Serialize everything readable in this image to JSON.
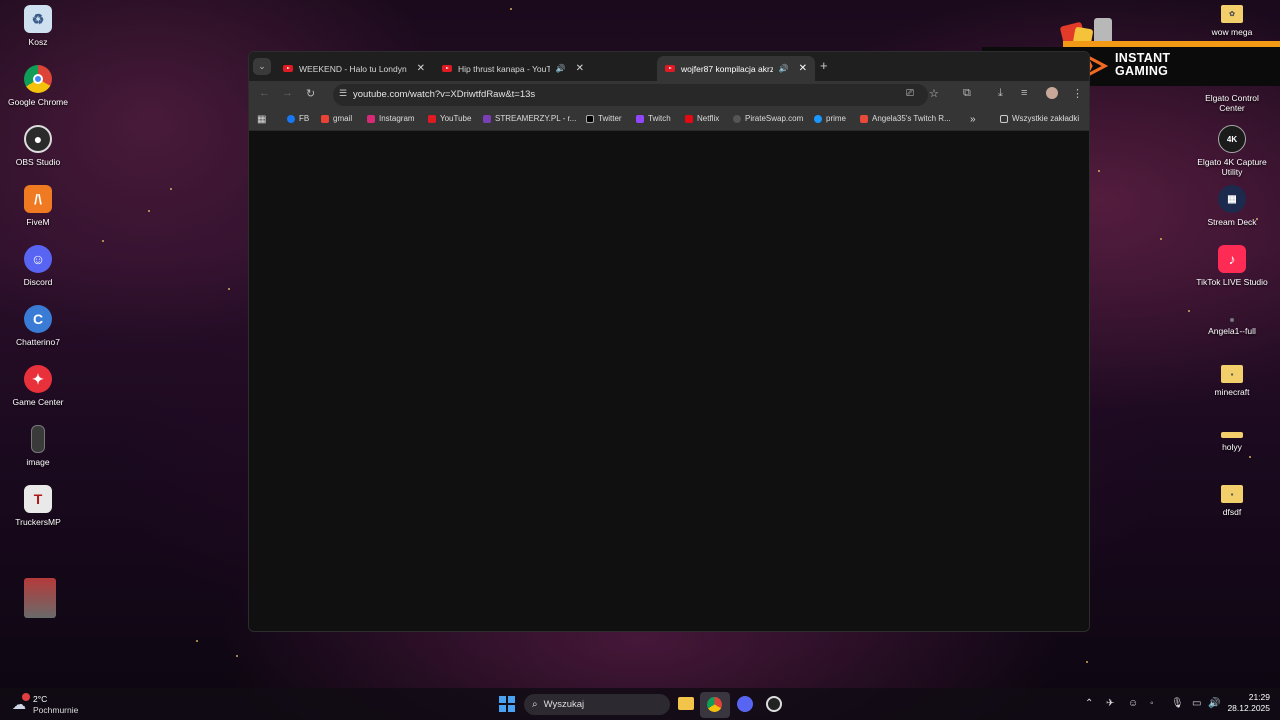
{
  "desktop_left": [
    "Kosz",
    "Google Chrome",
    "OBS Studio",
    "FiveM",
    "Discord",
    "Chatterino7",
    "Game Center",
    "image",
    "TruckersMP"
  ],
  "desktop_right": [
    "wow mega",
    "Elgato Control Center",
    "Elgato 4K Capture Utility",
    "Stream Deck",
    "TikTok LIVE Studio",
    "Angela1--full",
    "minecraft",
    "holyy",
    "dfsdf"
  ],
  "promo": {
    "line1": "INSTANT",
    "line2": "GAMING"
  },
  "browser": {
    "tabs": [
      {
        "title": "WEEKEND - Halo tu Londyn (Of"
      },
      {
        "title": "Hip thrust kanapa - YouTube"
      },
      {
        "title": "wojfer87 kompilacja akrzyki"
      }
    ],
    "url": "youtube.com/watch?v=XDriwtfdRaw&t=13s",
    "bookmarks": [
      "FB",
      "gmail",
      "Instagram",
      "YouTube",
      "STREAMERZY.PL - r...",
      "Twitter",
      "Twitch",
      "Netflix",
      "PirateSwap.com",
      "prime",
      "Angela35's Twitch R..."
    ],
    "all_bookmarks": "Wszystkie zakładki"
  },
  "taskbar": {
    "weather_temp": "2°C",
    "weather_desc": "Pochmurnie",
    "search_placeholder": "Wyszukaj",
    "time": "21:29",
    "date": "28.12.2025"
  }
}
